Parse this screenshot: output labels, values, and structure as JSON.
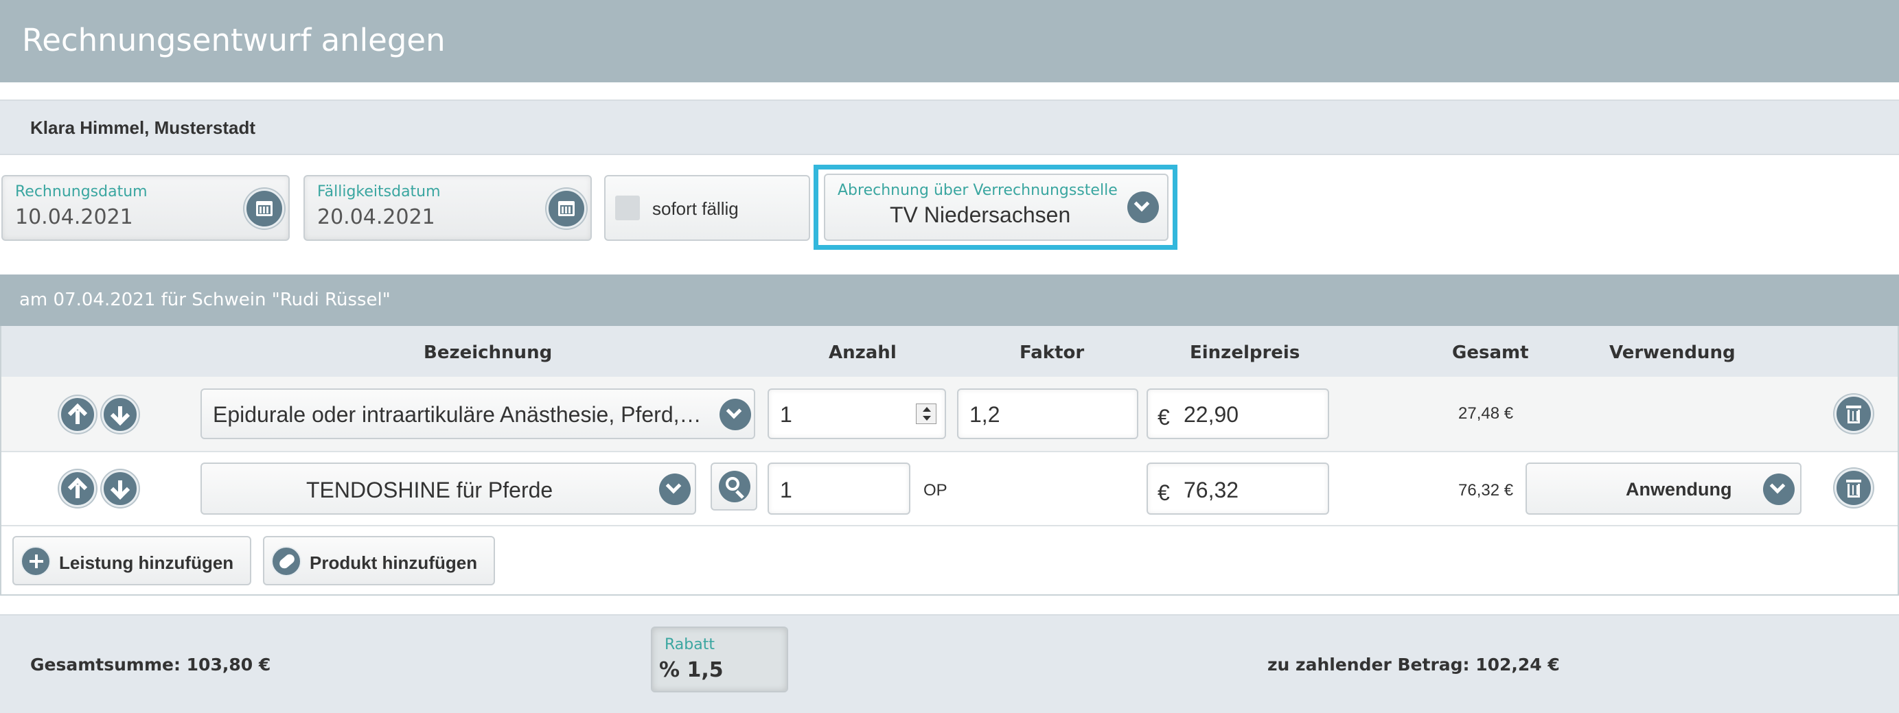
{
  "page": {
    "title": "Rechnungsentwurf anlegen"
  },
  "customer": {
    "name": "Klara Himmel, Musterstadt"
  },
  "dates": {
    "invoice_label": "Rechnungsdatum",
    "invoice_value": "10.04.2021",
    "due_label": "Fälligkeitsdatum",
    "due_value": "20.04.2021"
  },
  "immediate": {
    "label": "sofort fällig",
    "checked": false
  },
  "billing": {
    "label": "Abrechnung über Verrechnungsstelle",
    "value": "TV Niedersachsen"
  },
  "treatment": {
    "header": "am 07.04.2021 für Schwein \"Rudi Rüssel\""
  },
  "columns": {
    "bezeichnung": "Bezeichnung",
    "anzahl": "Anzahl",
    "faktor": "Faktor",
    "einzelpreis": "Einzelpreis",
    "gesamt": "Gesamt",
    "verwendung": "Verwendung"
  },
  "rows": [
    {
      "bezeichnung": "Epidurale oder intraartikuläre Anästhesie, Pferd,…",
      "anzahl": "1",
      "faktor": "1,2",
      "currency": "€",
      "einzelpreis": "22,90",
      "gesamt": "27,48 €",
      "verwendung": ""
    },
    {
      "bezeichnung": "TENDOSHINE für Pferde",
      "anzahl": "1",
      "unit": "OP",
      "currency": "€",
      "einzelpreis": "76,32",
      "gesamt": "76,32 €",
      "verwendung": "Anwendung"
    }
  ],
  "actions": {
    "add_service": "Leistung hinzufügen",
    "add_product": "Produkt hinzufügen"
  },
  "footer": {
    "total": "Gesamtsumme: 103,80 €",
    "discount_label": "Rabatt",
    "discount_symbol": "%",
    "discount_value": "1,5",
    "payable": "zu zahlender Betrag: 102,24 €"
  },
  "colors": {
    "header_bg": "#a8b8bf",
    "accent_teal": "#3aa6a0",
    "highlight_border": "#33b7dc",
    "icon_bg": "#5f7b8a"
  }
}
